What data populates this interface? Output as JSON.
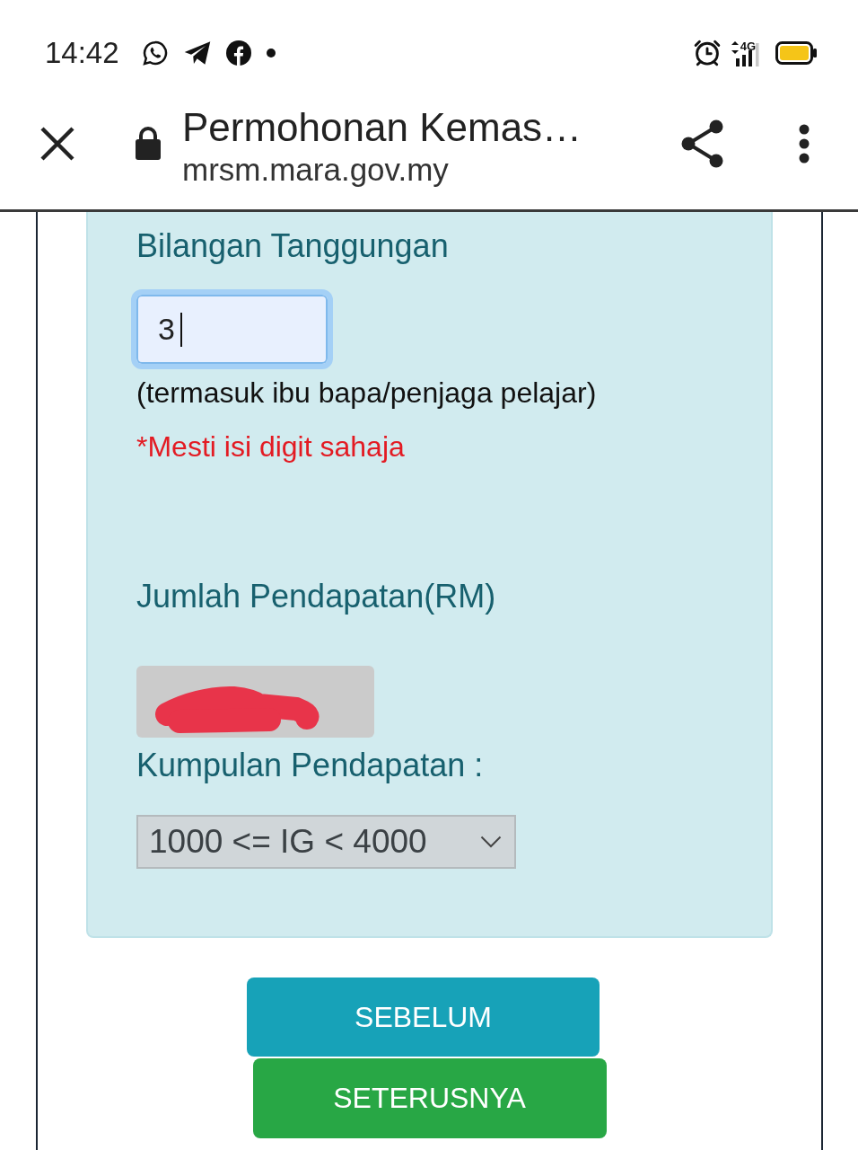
{
  "status_bar": {
    "time": "14:42",
    "network": "4G"
  },
  "browser_bar": {
    "title": "Permohonan Kemas…",
    "url": "mrsm.mara.gov.my"
  },
  "form": {
    "fields": [
      {
        "kind": "number",
        "label": "Bilangan Tanggungan",
        "value": "3",
        "focused": true,
        "hint": "(termasuk ibu bapa/penjaga pelajar)",
        "error": "*Mesti isi digit sahaja"
      },
      {
        "kind": "readonly",
        "label": "Jumlah Pendapatan(RM)",
        "redacted": true
      },
      {
        "kind": "select",
        "label": "Kumpulan Pendapatan :",
        "value": "1000 <= IG < 4000"
      }
    ]
  },
  "buttons": [
    {
      "kind": "secondary",
      "label": "SEBELUM"
    },
    {
      "kind": "primary",
      "label": "SETERUSNYA"
    }
  ]
}
